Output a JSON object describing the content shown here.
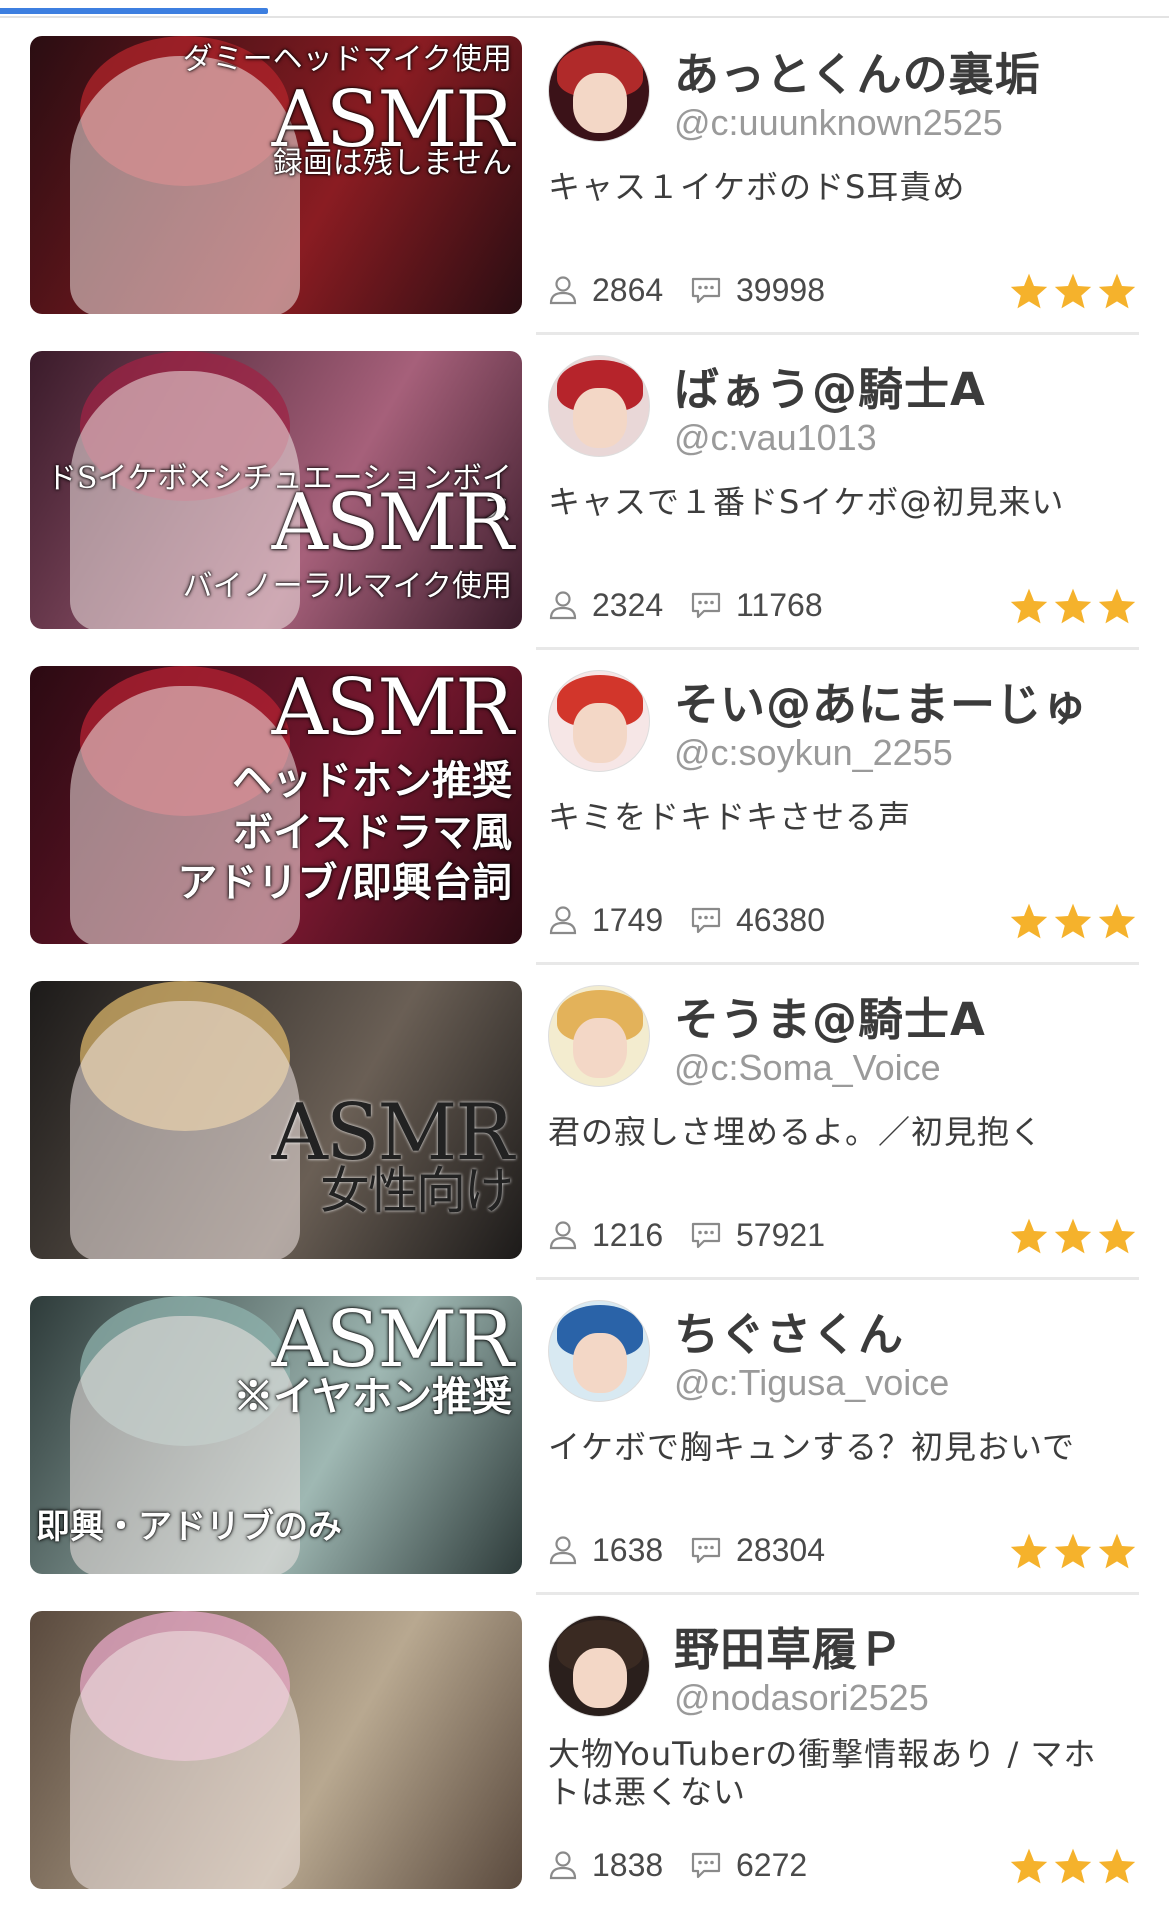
{
  "streams": [
    {
      "name": "あっとくんの裏垢",
      "handle": "@c:uuunknown2525",
      "description": "キャス１イケボのドS耳責め",
      "listeners": "2864",
      "comments": "39998",
      "rating": 3,
      "thumb_lines": [
        "ダミーヘッドマイク使用",
        "ASMR",
        "録画は残しません"
      ],
      "colors": {
        "bg1": "#2a0d12",
        "bg2": "#8a1c22",
        "hair": "#b3242b",
        "avatar_bg": "#3b1218",
        "avatar_hair": "#b02a2a"
      }
    },
    {
      "name": "ばぁう@騎士A",
      "handle": "@c:vau1013",
      "description": "キャスで１番ドSイケボ@初見来い",
      "listeners": "2324",
      "comments": "11768",
      "rating": 3,
      "thumb_lines": [
        "ドSイケボ×シチュエーションボイス",
        "ASMR",
        "バイノーラルマイク使用"
      ],
      "colors": {
        "bg1": "#3a1b2a",
        "bg2": "#a6607a",
        "hair": "#9d2344",
        "avatar_bg": "#e9d7d7",
        "avatar_hair": "#b6242b"
      }
    },
    {
      "name": "そい@あにまーじゅ",
      "handle": "@c:soykun_2255",
      "description": "キミをドキドキさせる声",
      "listeners": "1749",
      "comments": "46380",
      "rating": 3,
      "thumb_lines": [
        "ASMR",
        "ヘッドホン推奨",
        "ボイスドラマ風",
        "アドリブ/即興台詞"
      ],
      "colors": {
        "bg1": "#2b0a12",
        "bg2": "#7a1830",
        "hair": "#b52233",
        "avatar_bg": "#f6e6e6",
        "avatar_hair": "#d2362b"
      }
    },
    {
      "name": "そうま@騎士A",
      "handle": "@c:Soma_Voice",
      "description": "君の寂しさ埋めるよ。／初見抱く",
      "listeners": "1216",
      "comments": "57921",
      "rating": 3,
      "thumb_lines": [
        "ASMR",
        "女性向け"
      ],
      "colors": {
        "bg1": "#1c1a19",
        "bg2": "#6a5f55",
        "hair": "#d9b46a",
        "avatar_bg": "#f3eccf",
        "avatar_hair": "#e3b25a"
      }
    },
    {
      "name": "ちぐさくん",
      "handle": "@c:Tigusa_voice",
      "description": "イケボで胸キュンする？初見おいで",
      "listeners": "1638",
      "comments": "28304",
      "rating": 3,
      "thumb_lines": [
        "ASMR",
        "※イヤホン推奨",
        "即興・アドリブのみ"
      ],
      "colors": {
        "bg1": "#2e3b3a",
        "bg2": "#9fb8b3",
        "hair": "#8fb3ad",
        "avatar_bg": "#d8e9f2",
        "avatar_hair": "#2a63a8"
      }
    },
    {
      "name": "野田草履Ｐ",
      "handle": "@nodasori2525",
      "description": "大物YouTuberの衝撃情報あり / マホトは悪くない",
      "listeners": "1838",
      "comments": "6272",
      "rating": 3,
      "thumb_lines": [],
      "colors": {
        "bg1": "#5a4a3e",
        "bg2": "#b8a890",
        "hair": "#e8a8c8",
        "avatar_bg": "#2a1f1c",
        "avatar_hair": "#3a2a22"
      }
    }
  ],
  "icons": {
    "listeners": "person-icon",
    "comments": "comment-icon",
    "rating": "star-icon"
  },
  "accent": {
    "tab": "#3d7fe0",
    "star": "#f5b22c"
  }
}
